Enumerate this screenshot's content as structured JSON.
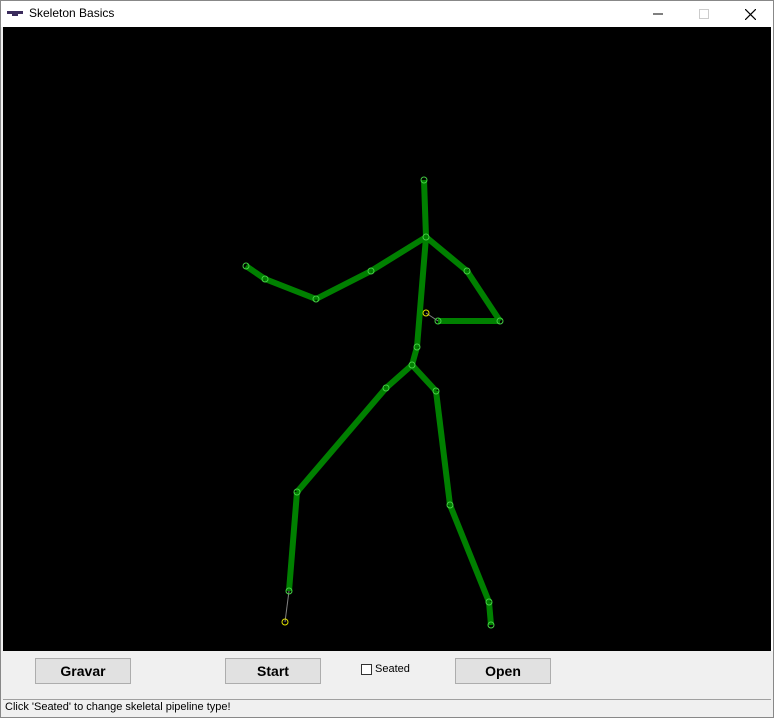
{
  "window": {
    "title": "Skeleton Basics",
    "icon": "kinect-sensor-icon"
  },
  "controls": {
    "minimize_icon": "minimize-icon",
    "maximize_icon": "maximize-icon",
    "close_icon": "close-icon"
  },
  "colors": {
    "canvas_background": "#000000",
    "tracked_bone": "#008000",
    "tracked_joint": "#44cc44",
    "inferred_joint": "#e0e000",
    "inferred_bone": "#808080"
  },
  "skeleton": {
    "tracking_state": "tracked"
  },
  "buttons": {
    "gravar_label": "Gravar",
    "start_label": "Start",
    "open_label": "Open"
  },
  "seated": {
    "label": "Seated",
    "checked": false
  },
  "status": {
    "text": "Click 'Seated' to change skeletal pipeline type!"
  }
}
